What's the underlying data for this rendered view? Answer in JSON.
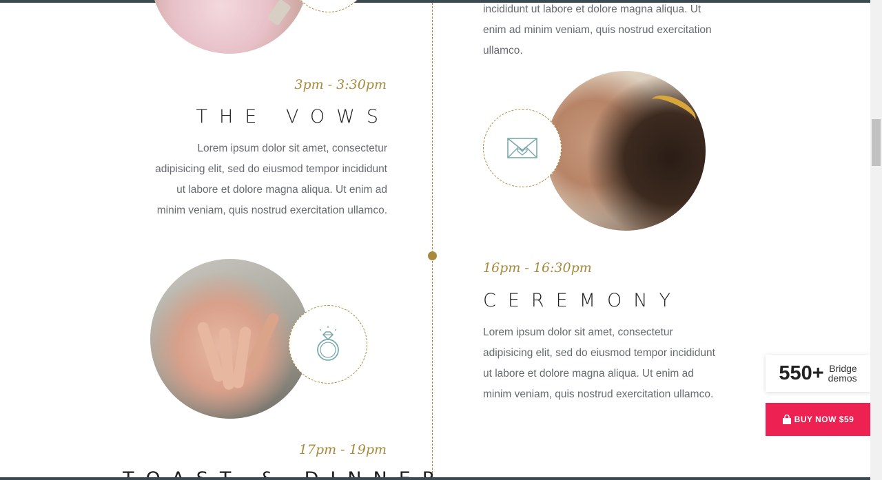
{
  "events": [
    {
      "time": "3pm - 3:30pm",
      "title": "THE VOWS",
      "text": "Lorem ipsum dolor sit amet, consectetur adipisicing elit, sed do eiusmod tempor incididunt ut labore et dolore magna aliqua. Ut enim ad minim veniam, quis nostrud exercitation ullamco."
    },
    {
      "time": "16pm - 16:30pm",
      "title": "CEREMONY",
      "text": "Lorem ipsum dolor sit amet, consectetur adipisicing elit, sed do eiusmod tempor incididunt ut labore et dolore magna aliqua. Ut enim ad minim veniam, quis nostrud exercitation ullamco."
    },
    {
      "time": "17pm - 19pm",
      "title": "TOAST & DINNER"
    }
  ],
  "top_right_text": "incididunt ut labore et dolore magna aliqua. Ut enim ad minim veniam, quis nostrud exercitation ullamco.",
  "promo": {
    "demos_count": "550+",
    "demos_label_1": "Bridge",
    "demos_label_2": "demos",
    "buy_label": "BUY NOW $59"
  },
  "colors": {
    "accent": "#a88a3a",
    "icon_teal": "#7aa9ac",
    "buy_button": "#ee2252"
  },
  "icons": [
    "envelope-heart-icon",
    "ring-icon",
    "shopping-bag-icon"
  ]
}
